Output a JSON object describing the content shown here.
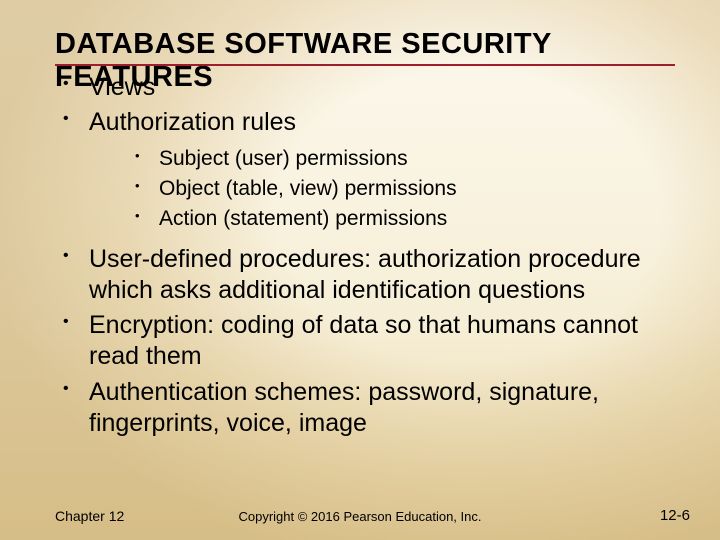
{
  "title": "DATABASE SOFTWARE SECURITY FEATURES",
  "bullets": {
    "b0": "Views",
    "b1": "Authorization rules",
    "b1_sub": {
      "s0": "Subject (user) permissions",
      "s1": "Object (table, view) permissions",
      "s2": "Action (statement) permissions"
    },
    "b2": "User-defined procedures: authorization procedure which asks additional identification questions",
    "b3": "Encryption: coding of data so that humans cannot read them",
    "b4": "Authentication schemes: password, signature, fingerprints, voice, image"
  },
  "footer": {
    "left": "Chapter 12",
    "center": "Copyright © 2016 Pearson Education, Inc.",
    "right": "12-6"
  }
}
